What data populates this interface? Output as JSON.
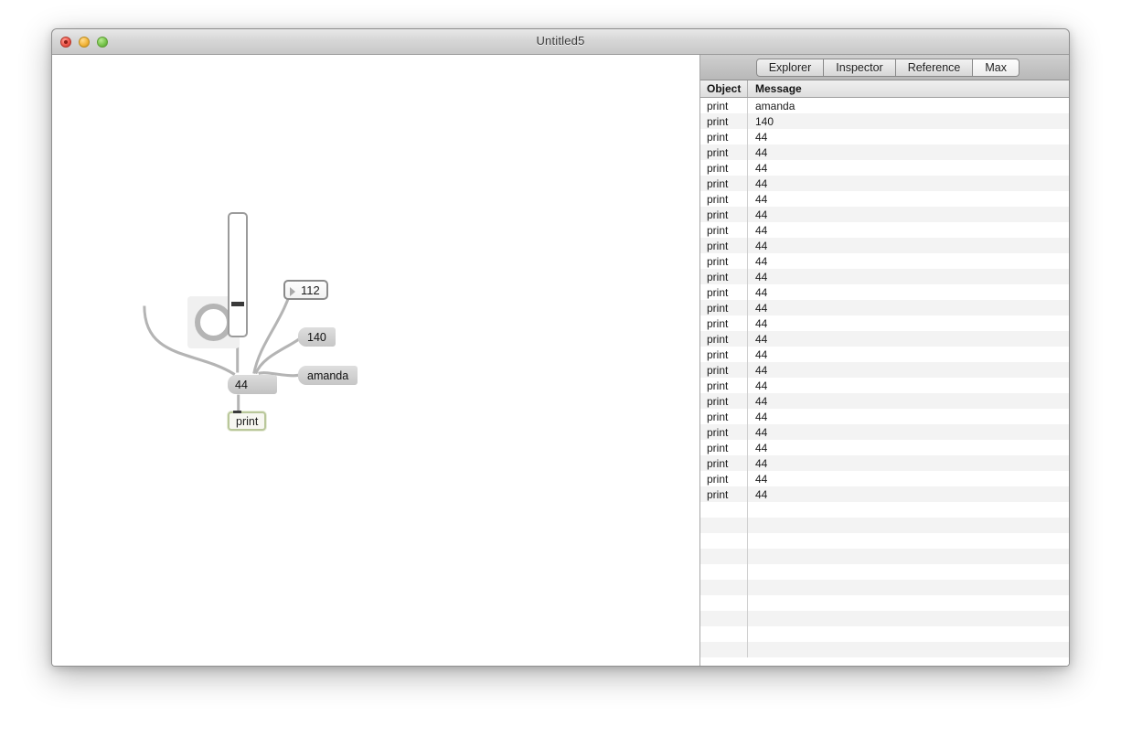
{
  "window": {
    "title": "Untitled5",
    "controls": {
      "close": "close",
      "minimize": "minimize",
      "zoom": "zoom"
    }
  },
  "patcher": {
    "objects": [
      {
        "type": "bang",
        "name": "bang-object",
        "label": ""
      },
      {
        "type": "slider",
        "name": "vertical-slider",
        "label": ""
      },
      {
        "type": "number",
        "name": "number-box",
        "label": "112"
      },
      {
        "type": "message",
        "name": "message-box-140",
        "label": "140"
      },
      {
        "type": "message",
        "name": "message-box-amanda",
        "label": "amanda"
      },
      {
        "type": "message",
        "name": "message-box-44",
        "label": "44"
      },
      {
        "type": "object",
        "name": "print-object",
        "label": "print"
      }
    ]
  },
  "console": {
    "tabs": [
      {
        "label": "Explorer",
        "active": false
      },
      {
        "label": "Inspector",
        "active": false
      },
      {
        "label": "Reference",
        "active": false
      },
      {
        "label": "Max",
        "active": true
      }
    ],
    "columns": {
      "object": "Object",
      "message": "Message"
    },
    "rows": [
      {
        "object": "print",
        "message": "amanda"
      },
      {
        "object": "print",
        "message": "140"
      },
      {
        "object": "print",
        "message": "44"
      },
      {
        "object": "print",
        "message": "44"
      },
      {
        "object": "print",
        "message": "44"
      },
      {
        "object": "print",
        "message": "44"
      },
      {
        "object": "print",
        "message": "44"
      },
      {
        "object": "print",
        "message": "44"
      },
      {
        "object": "print",
        "message": "44"
      },
      {
        "object": "print",
        "message": "44"
      },
      {
        "object": "print",
        "message": "44"
      },
      {
        "object": "print",
        "message": "44"
      },
      {
        "object": "print",
        "message": "44"
      },
      {
        "object": "print",
        "message": "44"
      },
      {
        "object": "print",
        "message": "44"
      },
      {
        "object": "print",
        "message": "44"
      },
      {
        "object": "print",
        "message": "44"
      },
      {
        "object": "print",
        "message": "44"
      },
      {
        "object": "print",
        "message": "44"
      },
      {
        "object": "print",
        "message": "44"
      },
      {
        "object": "print",
        "message": "44"
      },
      {
        "object": "print",
        "message": "44"
      },
      {
        "object": "print",
        "message": "44"
      },
      {
        "object": "print",
        "message": "44"
      },
      {
        "object": "print",
        "message": "44"
      },
      {
        "object": "print",
        "message": "44"
      }
    ],
    "empty_rows": 10
  },
  "toolbar_left": [
    {
      "name": "lock-icon",
      "glyph": "lock",
      "enabled": true
    },
    {
      "name": "add-object-icon",
      "glyph": "shapes",
      "enabled": true
    },
    {
      "name": "telescope-icon",
      "glyph": "telescope",
      "enabled": false
    },
    {
      "name": "delete-box-icon",
      "glyph": "xbox",
      "enabled": false
    },
    {
      "name": "presentation-icon",
      "glyph": "chart",
      "enabled": true
    },
    {
      "name": "info-icon",
      "glyph": "info",
      "enabled": false
    },
    {
      "name": "debug-icon",
      "glyph": "debug",
      "enabled": true
    },
    {
      "name": "grid-icon",
      "glyph": "grid",
      "enabled": false
    },
    {
      "name": "timing-icon",
      "glyph": "timing",
      "enabled": false
    }
  ],
  "toolbar_layout": [
    {
      "name": "layout-horizontal-icon"
    },
    {
      "name": "layout-vertical-icon"
    }
  ],
  "toolbar_right": [
    {
      "name": "clear-console-icon",
      "glyph": "x",
      "enabled": true
    },
    {
      "name": "clock-icon",
      "glyph": "clock",
      "enabled": true
    },
    {
      "name": "console-info-icon",
      "glyph": "info",
      "enabled": false
    },
    {
      "name": "back-arrow-icon",
      "glyph": "back",
      "enabled": false
    }
  ],
  "colors": {
    "canvas": "#ffffff",
    "selected_object_border": "#b9c79a",
    "cord": "#b4b4b4",
    "chrome": "#d0d0d0"
  }
}
